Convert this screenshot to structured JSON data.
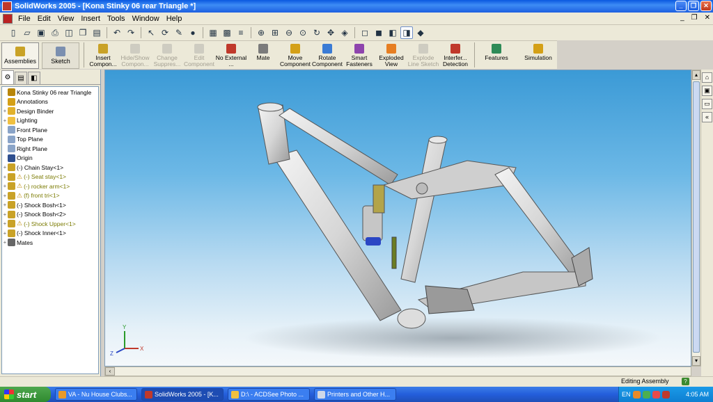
{
  "window": {
    "title": "SolidWorks 2005 - [Kona Stinky 06 rear Triangle *]",
    "buttons": [
      "_",
      "❐",
      "✕"
    ]
  },
  "menubar": {
    "items": [
      "File",
      "Edit",
      "View",
      "Insert",
      "Tools",
      "Window",
      "Help"
    ],
    "doc_buttons": [
      "_",
      "❐",
      "✕"
    ]
  },
  "command_manager": {
    "tabs": [
      {
        "label": "Assemblies",
        "icon": "assembly-icon"
      },
      {
        "label": "Sketch",
        "icon": "sketch-icon"
      }
    ],
    "items": [
      {
        "label": "Insert Compon...",
        "icon": "insert-component-icon",
        "enabled": true,
        "color": "#c9a227"
      },
      {
        "label": "Hide/Show Compon...",
        "icon": "hide-show-icon",
        "enabled": false,
        "color": "#999999"
      },
      {
        "label": "Change Suppres...",
        "icon": "change-suppression-icon",
        "enabled": false,
        "color": "#999999"
      },
      {
        "label": "Edit Component",
        "icon": "edit-component-icon",
        "enabled": false,
        "color": "#999999"
      },
      {
        "label": "No External ...",
        "icon": "no-external-icon",
        "enabled": true,
        "color": "#c0392b"
      },
      {
        "label": "Mate",
        "icon": "mate-icon",
        "enabled": true,
        "color": "#7b7b7b"
      },
      {
        "label": "Move Component",
        "icon": "move-component-icon",
        "enabled": true,
        "color": "#d4a017"
      },
      {
        "label": "Rotate Component",
        "icon": "rotate-component-icon",
        "enabled": true,
        "color": "#3a7bd5"
      },
      {
        "label": "Smart Fasteners",
        "icon": "smart-fasteners-icon",
        "enabled": true,
        "color": "#8e44ad"
      },
      {
        "label": "Exploded View",
        "icon": "exploded-view-icon",
        "enabled": true,
        "color": "#e67e22"
      },
      {
        "label": "Explode Line Sketch",
        "icon": "explode-line-sketch-icon",
        "enabled": false,
        "color": "#999999"
      },
      {
        "label": "Interfer... Detection",
        "icon": "interference-detection-icon",
        "enabled": true,
        "color": "#c0392b"
      }
    ],
    "extra": [
      {
        "label": "Features",
        "icon": "features-icon",
        "color": "#2e8b57"
      },
      {
        "label": "Simulation",
        "icon": "simulation-icon",
        "color": "#d4a017"
      }
    ]
  },
  "toolbar": {
    "icons": [
      "new-icon",
      "open-icon",
      "save-icon",
      "print-icon",
      "print-preview-icon",
      "copy-icon",
      "paste-icon",
      "undo-icon",
      "redo-icon",
      "select-icon",
      "rebuild-icon",
      "edit-icon",
      "traffic-light-icon",
      "grid-icon",
      "options-icon",
      "layers-icon",
      "zoom-to-fit-icon",
      "zoom-window-icon",
      "zoom-in-out-icon",
      "zoom-selection-icon",
      "rotate-view-icon",
      "pan-icon",
      "view-orientation-icon",
      "wireframe-icon",
      "hidden-lines-icon",
      "hidden-removed-icon",
      "shaded-edges-icon",
      "shaded-icon"
    ]
  },
  "feature_tree": {
    "tabs": [
      "feature-manager-tab-icon",
      "property-manager-tab-icon",
      "configuration-manager-tab-icon"
    ],
    "items": [
      {
        "label": "Kona Stinky 06 rear Triangle",
        "icon": "assembly-icon",
        "expander": "",
        "warn": false,
        "color": "#b8860b"
      },
      {
        "label": "Annotations",
        "icon": "annotations-icon",
        "expander": "",
        "warn": false,
        "color": "#d4a017"
      },
      {
        "label": "Design Binder",
        "icon": "design-binder-icon",
        "expander": "+",
        "warn": false,
        "color": "#e1b12c"
      },
      {
        "label": "Lighting",
        "icon": "lighting-icon",
        "expander": "+",
        "warn": false,
        "color": "#f0c040"
      },
      {
        "label": "Front Plane",
        "icon": "plane-icon",
        "expander": "",
        "warn": false,
        "color": "#8aa4c8"
      },
      {
        "label": "Top Plane",
        "icon": "plane-icon",
        "expander": "",
        "warn": false,
        "color": "#8aa4c8"
      },
      {
        "label": "Right Plane",
        "icon": "plane-icon",
        "expander": "",
        "warn": false,
        "color": "#8aa4c8"
      },
      {
        "label": "Origin",
        "icon": "origin-icon",
        "expander": "",
        "warn": false,
        "color": "#2f4f8f"
      },
      {
        "label": "(-) Chain Stay<1>",
        "icon": "part-icon",
        "expander": "+",
        "warn": false,
        "color": "#c9a227"
      },
      {
        "label": "(-) Seat stay<1>",
        "icon": "part-icon",
        "expander": "+",
        "warn": true,
        "color": "#c9a227"
      },
      {
        "label": "(-) rocker arm<1>",
        "icon": "part-icon",
        "expander": "+",
        "warn": true,
        "color": "#c9a227"
      },
      {
        "label": "(f) front tri<1>",
        "icon": "part-icon",
        "expander": "+",
        "warn": true,
        "color": "#c9a227"
      },
      {
        "label": "(-) Shock Bosh<1>",
        "icon": "part-icon",
        "expander": "+",
        "warn": false,
        "color": "#c9a227"
      },
      {
        "label": "(-) Shock Bosh<2>",
        "icon": "part-icon",
        "expander": "+",
        "warn": false,
        "color": "#c9a227"
      },
      {
        "label": "(-) Shock Upper<1>",
        "icon": "part-icon",
        "expander": "+",
        "warn": true,
        "color": "#c9a227"
      },
      {
        "label": "(-) Shock Inner<1>",
        "icon": "part-icon",
        "expander": "+",
        "warn": false,
        "color": "#c9a227"
      },
      {
        "label": "Mates",
        "icon": "mates-icon",
        "expander": "+",
        "warn": false,
        "color": "#666666"
      }
    ]
  },
  "viewport": {
    "model": "bike-frame-model",
    "triad": {
      "x": "X",
      "y": "Y",
      "z": "Z"
    }
  },
  "taskpane": {
    "icons": [
      "home-icon",
      "tasks-icon",
      "file-explorer-icon",
      "collapse-icon"
    ]
  },
  "statusbar": {
    "text": "Editing Assembly",
    "help": "?"
  },
  "taskbar": {
    "start": "start",
    "tasks": [
      {
        "label": "VA - Nu House Clubs...",
        "icon": "winamp-icon",
        "active": false
      },
      {
        "label": "SolidWorks 2005 - [K...",
        "icon": "solidworks-icon",
        "active": true
      },
      {
        "label": "D:\\ - ACDSee Photo ...",
        "icon": "acdsee-icon",
        "active": false
      },
      {
        "label": "Printers and Other H...",
        "icon": "printers-icon",
        "active": false
      }
    ],
    "tray": {
      "lang": "EN",
      "clock": "4:05 AM"
    }
  }
}
